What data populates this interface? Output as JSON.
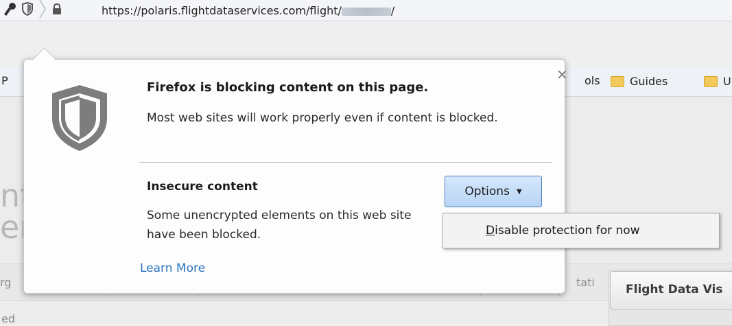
{
  "address_bar": {
    "url_prefix": "https://polaris.flightdataservices.com/flight/",
    "url_suffix": "/"
  },
  "bookmarks": [
    {
      "label": "P",
      "icon": "folder-icon"
    },
    {
      "label": "ols",
      "icon": "folder-icon"
    },
    {
      "label": "Guides",
      "icon": "folder-icon"
    },
    {
      "label": "U",
      "icon": "folder-icon"
    }
  ],
  "popup": {
    "title": "Firefox is blocking content on this page.",
    "description": "Most web sites will work properly even if content is blocked.",
    "section_title": "Insecure content",
    "section_description": "Some unencrypted elements on this web site have been blocked.",
    "options_label": "Options",
    "learn_more": "Learn More",
    "close_symbol": "×",
    "menu_item_mnemonic": "D",
    "menu_item_rest": "isable protection for now"
  },
  "page_fragments": {
    "left_big": "nt",
    "left_big2": "er",
    "left_small": "rg",
    "left_bottom": "ed",
    "stati": "tati",
    "flight_data_vis": "Flight Data Vis"
  },
  "colors": {
    "link": "#2b72c0",
    "options_bg": "#c9e0f8",
    "shield": "#7d7d7d"
  }
}
